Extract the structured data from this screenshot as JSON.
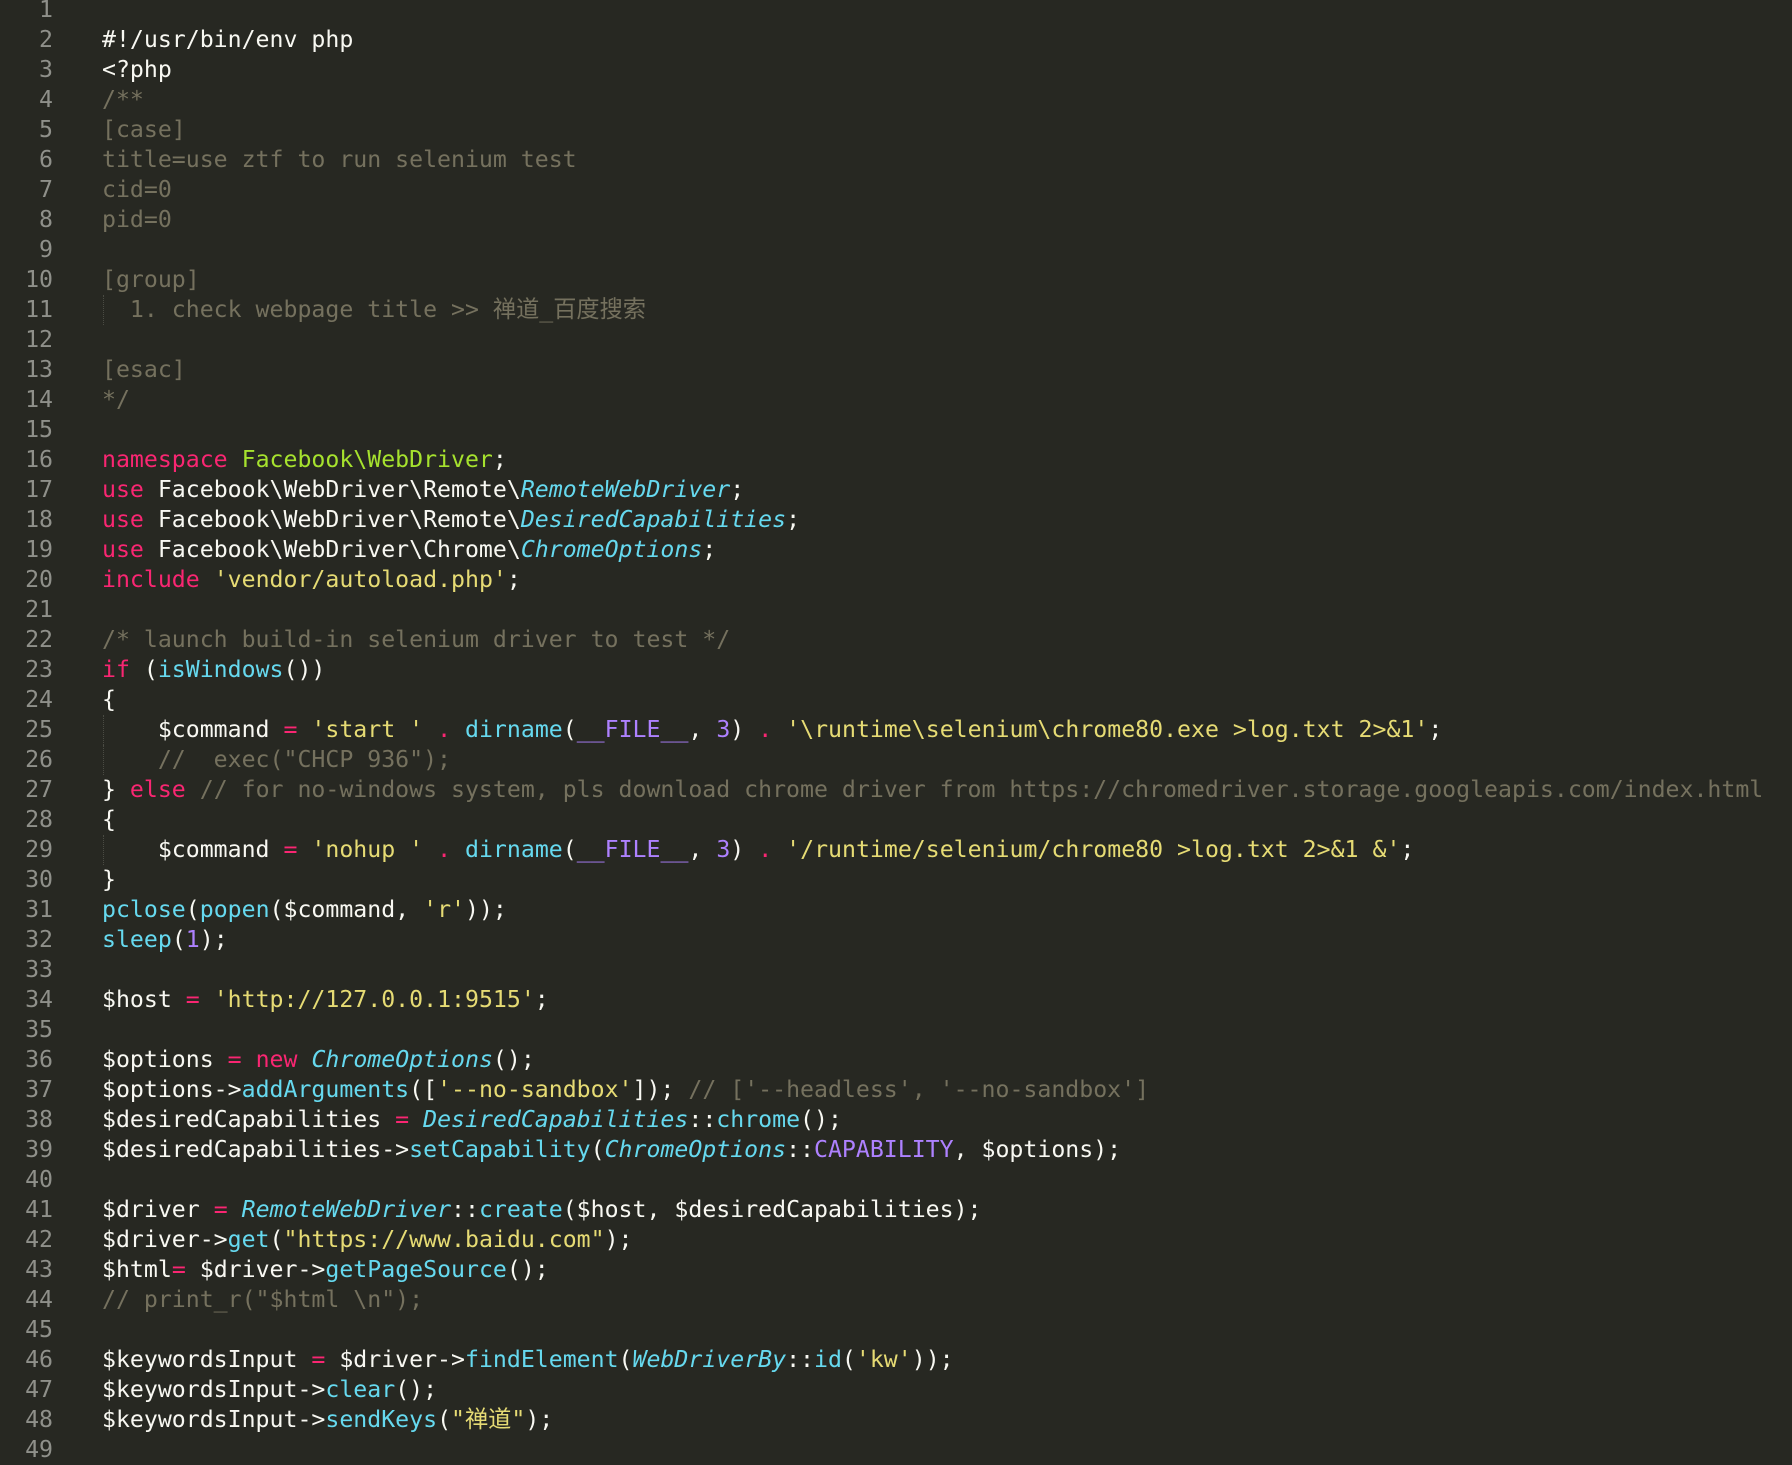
{
  "colors": {
    "background": "#272822",
    "foreground": "#f8f8f2",
    "keyword": "#f92672",
    "comment": "#75715e",
    "string": "#e6db74",
    "function": "#66d9ef",
    "constant": "#ae81ff",
    "namespace": "#a6e22e",
    "line_number": "#8f908a"
  },
  "lines": [
    {
      "n": "1",
      "t": []
    },
    {
      "n": "2",
      "t": [
        [
          "p",
          "#!/usr/bin/env php"
        ]
      ]
    },
    {
      "n": "3",
      "t": [
        [
          "p",
          "<?php"
        ]
      ]
    },
    {
      "n": "4",
      "t": [
        [
          "c",
          "/**"
        ]
      ]
    },
    {
      "n": "5",
      "t": [
        [
          "c",
          "[case]"
        ]
      ]
    },
    {
      "n": "6",
      "t": [
        [
          "c",
          "title=use ztf to run selenium test"
        ]
      ]
    },
    {
      "n": "7",
      "t": [
        [
          "c",
          "cid=0"
        ]
      ]
    },
    {
      "n": "8",
      "t": [
        [
          "c",
          "pid=0"
        ]
      ]
    },
    {
      "n": "9",
      "t": []
    },
    {
      "n": "10",
      "t": [
        [
          "c",
          "[group]"
        ]
      ]
    },
    {
      "n": "11",
      "g": true,
      "t": [
        [
          "c",
          "  1. check webpage title >> 禅道_百度搜索"
        ]
      ]
    },
    {
      "n": "12",
      "t": []
    },
    {
      "n": "13",
      "t": [
        [
          "c",
          "[esac]"
        ]
      ]
    },
    {
      "n": "14",
      "t": [
        [
          "c",
          "*/"
        ]
      ]
    },
    {
      "n": "15",
      "t": []
    },
    {
      "n": "16",
      "t": [
        [
          "k",
          "namespace"
        ],
        [
          "p",
          " "
        ],
        [
          "g",
          "Facebook\\WebDriver"
        ],
        [
          "p",
          ";"
        ]
      ]
    },
    {
      "n": "17",
      "t": [
        [
          "k",
          "use"
        ],
        [
          "p",
          " Facebook\\WebDriver\\Remote\\"
        ],
        [
          "i",
          "RemoteWebDriver"
        ],
        [
          "p",
          ";"
        ]
      ]
    },
    {
      "n": "18",
      "t": [
        [
          "k",
          "use"
        ],
        [
          "p",
          " Facebook\\WebDriver\\Remote\\"
        ],
        [
          "i",
          "DesiredCapabilities"
        ],
        [
          "p",
          ";"
        ]
      ]
    },
    {
      "n": "19",
      "t": [
        [
          "k",
          "use"
        ],
        [
          "p",
          " Facebook\\WebDriver\\Chrome\\"
        ],
        [
          "i",
          "ChromeOptions"
        ],
        [
          "p",
          ";"
        ]
      ]
    },
    {
      "n": "20",
      "t": [
        [
          "k",
          "include"
        ],
        [
          "p",
          " "
        ],
        [
          "s",
          "'vendor/autoload.php'"
        ],
        [
          "p",
          ";"
        ]
      ]
    },
    {
      "n": "21",
      "t": []
    },
    {
      "n": "22",
      "t": [
        [
          "c",
          "/* launch build-in selenium driver to test */"
        ]
      ]
    },
    {
      "n": "23",
      "t": [
        [
          "k",
          "if"
        ],
        [
          "p",
          " ("
        ],
        [
          "f",
          "isWindows"
        ],
        [
          "p",
          "())"
        ]
      ]
    },
    {
      "n": "24",
      "t": [
        [
          "p",
          "{"
        ]
      ]
    },
    {
      "n": "25",
      "g": true,
      "t": [
        [
          "p",
          "    $command "
        ],
        [
          "k",
          "="
        ],
        [
          "p",
          " "
        ],
        [
          "s",
          "'start '"
        ],
        [
          "p",
          " "
        ],
        [
          "k",
          "."
        ],
        [
          "p",
          " "
        ],
        [
          "f",
          "dirname"
        ],
        [
          "p",
          "("
        ],
        [
          "n",
          "__FILE__"
        ],
        [
          "p",
          ", "
        ],
        [
          "n",
          "3"
        ],
        [
          "p",
          ") "
        ],
        [
          "k",
          "."
        ],
        [
          "p",
          " "
        ],
        [
          "s",
          "'\\runtime\\selenium\\chrome80.exe >log.txt 2>&1'"
        ],
        [
          "p",
          ";"
        ]
      ]
    },
    {
      "n": "26",
      "g": true,
      "t": [
        [
          "c",
          "    //  exec(\"CHCP 936\");"
        ]
      ]
    },
    {
      "n": "27",
      "t": [
        [
          "p",
          "} "
        ],
        [
          "k",
          "else"
        ],
        [
          "p",
          " "
        ],
        [
          "c",
          "// for no-windows system, pls download chrome driver from https://chromedriver.storage.googleapis.com/index.html"
        ]
      ]
    },
    {
      "n": "28",
      "t": [
        [
          "p",
          "{"
        ]
      ]
    },
    {
      "n": "29",
      "g": true,
      "t": [
        [
          "p",
          "    $command "
        ],
        [
          "k",
          "="
        ],
        [
          "p",
          " "
        ],
        [
          "s",
          "'nohup '"
        ],
        [
          "p",
          " "
        ],
        [
          "k",
          "."
        ],
        [
          "p",
          " "
        ],
        [
          "f",
          "dirname"
        ],
        [
          "p",
          "("
        ],
        [
          "n",
          "__FILE__"
        ],
        [
          "p",
          ", "
        ],
        [
          "n",
          "3"
        ],
        [
          "p",
          ") "
        ],
        [
          "k",
          "."
        ],
        [
          "p",
          " "
        ],
        [
          "s",
          "'/runtime/selenium/chrome80 >log.txt 2>&1 &'"
        ],
        [
          "p",
          ";"
        ]
      ]
    },
    {
      "n": "30",
      "t": [
        [
          "p",
          "}"
        ]
      ]
    },
    {
      "n": "31",
      "t": [
        [
          "f",
          "pclose"
        ],
        [
          "p",
          "("
        ],
        [
          "f",
          "popen"
        ],
        [
          "p",
          "($command, "
        ],
        [
          "s",
          "'r'"
        ],
        [
          "p",
          "));"
        ]
      ]
    },
    {
      "n": "32",
      "t": [
        [
          "f",
          "sleep"
        ],
        [
          "p",
          "("
        ],
        [
          "n",
          "1"
        ],
        [
          "p",
          ");"
        ]
      ]
    },
    {
      "n": "33",
      "t": []
    },
    {
      "n": "34",
      "t": [
        [
          "p",
          "$host "
        ],
        [
          "k",
          "="
        ],
        [
          "p",
          " "
        ],
        [
          "s",
          "'http://127.0.0.1:9515'"
        ],
        [
          "p",
          ";"
        ]
      ]
    },
    {
      "n": "35",
      "t": []
    },
    {
      "n": "36",
      "t": [
        [
          "p",
          "$options "
        ],
        [
          "k",
          "="
        ],
        [
          "p",
          " "
        ],
        [
          "k",
          "new"
        ],
        [
          "p",
          " "
        ],
        [
          "i",
          "ChromeOptions"
        ],
        [
          "p",
          "();"
        ]
      ]
    },
    {
      "n": "37",
      "t": [
        [
          "p",
          "$options->"
        ],
        [
          "f",
          "addArguments"
        ],
        [
          "p",
          "(["
        ],
        [
          "s",
          "'--no-sandbox'"
        ],
        [
          "p",
          "]); "
        ],
        [
          "c",
          "// ['--headless', '--no-sandbox']"
        ]
      ]
    },
    {
      "n": "38",
      "t": [
        [
          "p",
          "$desiredCapabilities "
        ],
        [
          "k",
          "="
        ],
        [
          "p",
          " "
        ],
        [
          "i",
          "DesiredCapabilities"
        ],
        [
          "p",
          "::"
        ],
        [
          "f",
          "chrome"
        ],
        [
          "p",
          "();"
        ]
      ]
    },
    {
      "n": "39",
      "t": [
        [
          "p",
          "$desiredCapabilities->"
        ],
        [
          "f",
          "setCapability"
        ],
        [
          "p",
          "("
        ],
        [
          "i",
          "ChromeOptions"
        ],
        [
          "p",
          "::"
        ],
        [
          "n",
          "CAPABILITY"
        ],
        [
          "p",
          ", $options);"
        ]
      ]
    },
    {
      "n": "40",
      "t": []
    },
    {
      "n": "41",
      "t": [
        [
          "p",
          "$driver "
        ],
        [
          "k",
          "="
        ],
        [
          "p",
          " "
        ],
        [
          "i",
          "RemoteWebDriver"
        ],
        [
          "p",
          "::"
        ],
        [
          "f",
          "create"
        ],
        [
          "p",
          "($host, $desiredCapabilities);"
        ]
      ]
    },
    {
      "n": "42",
      "t": [
        [
          "p",
          "$driver->"
        ],
        [
          "f",
          "get"
        ],
        [
          "p",
          "("
        ],
        [
          "s",
          "\"https://www.baidu.com\""
        ],
        [
          "p",
          ");"
        ]
      ]
    },
    {
      "n": "43",
      "t": [
        [
          "p",
          "$html"
        ],
        [
          "k",
          "="
        ],
        [
          "p",
          " $driver->"
        ],
        [
          "f",
          "getPageSource"
        ],
        [
          "p",
          "();"
        ]
      ]
    },
    {
      "n": "44",
      "t": [
        [
          "c",
          "// print_r(\"$html \\n\");"
        ]
      ]
    },
    {
      "n": "45",
      "t": []
    },
    {
      "n": "46",
      "t": [
        [
          "p",
          "$keywordsInput "
        ],
        [
          "k",
          "="
        ],
        [
          "p",
          " $driver->"
        ],
        [
          "f",
          "findElement"
        ],
        [
          "p",
          "("
        ],
        [
          "i",
          "WebDriverBy"
        ],
        [
          "p",
          "::"
        ],
        [
          "f",
          "id"
        ],
        [
          "p",
          "("
        ],
        [
          "s",
          "'kw'"
        ],
        [
          "p",
          "));"
        ]
      ]
    },
    {
      "n": "47",
      "t": [
        [
          "p",
          "$keywordsInput->"
        ],
        [
          "f",
          "clear"
        ],
        [
          "p",
          "();"
        ]
      ]
    },
    {
      "n": "48",
      "t": [
        [
          "p",
          "$keywordsInput->"
        ],
        [
          "f",
          "sendKeys"
        ],
        [
          "p",
          "("
        ],
        [
          "s",
          "\"禅道\""
        ],
        [
          "p",
          ");"
        ]
      ]
    },
    {
      "n": "49",
      "t": []
    }
  ]
}
